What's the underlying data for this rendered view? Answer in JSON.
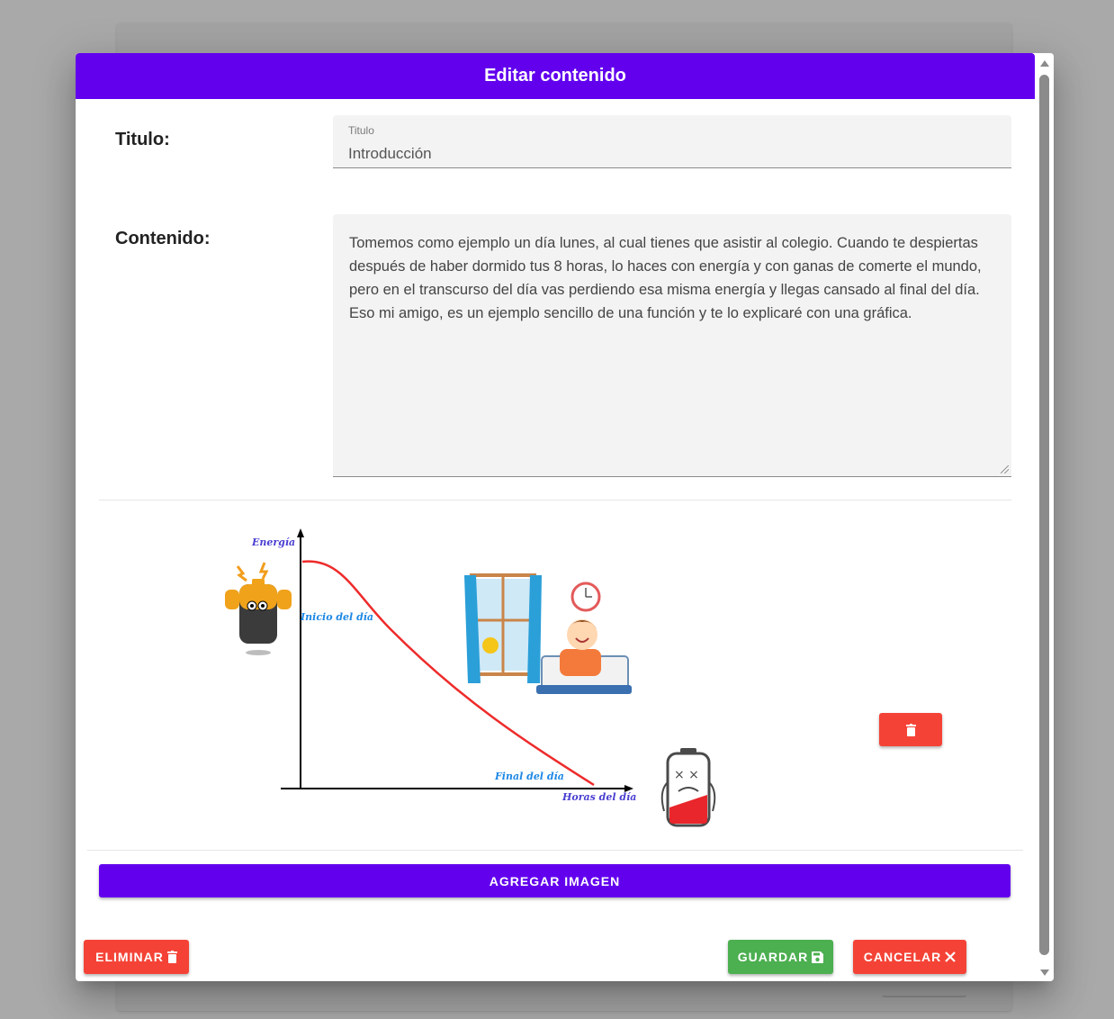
{
  "dialog": {
    "title": "Editar contenido",
    "titulo_label": "Titulo:",
    "titulo_field": {
      "floating_label": "Titulo",
      "value": "Introducción"
    },
    "contenido_label": "Contenido:",
    "contenido_value": "Tomemos como ejemplo un día lunes, al cual tienes que asistir al colegio. Cuando te despiertas después de haber dormido tus 8 horas, lo haces con energía y con ganas de comerte el mundo, pero en el transcurso del día vas perdiendo esa misma energía y llegas cansado al final del día. Eso mi amigo, es un ejemplo sencillo de una función y te lo explicaré con una gráfica.",
    "graph_image": {
      "y_axis_label": "Energía",
      "x_axis_label": "Horas del día",
      "start_label": "Inicio del día",
      "end_label": "Final del día",
      "curve_color": "#ee2b2b",
      "label_color": "#4a3fd1"
    },
    "add_image_label": "AGREGAR IMAGEN",
    "footer": {
      "delete_label": "ELIMINAR",
      "save_label": "GUARDAR",
      "cancel_label": "CANCELAR"
    },
    "icons": {
      "delete": "trash-icon",
      "save": "floppy-disk-icon",
      "cancel": "close-icon"
    },
    "colors": {
      "primary": "#6200ee",
      "danger": "#f44336",
      "success": "#4caf50"
    }
  }
}
